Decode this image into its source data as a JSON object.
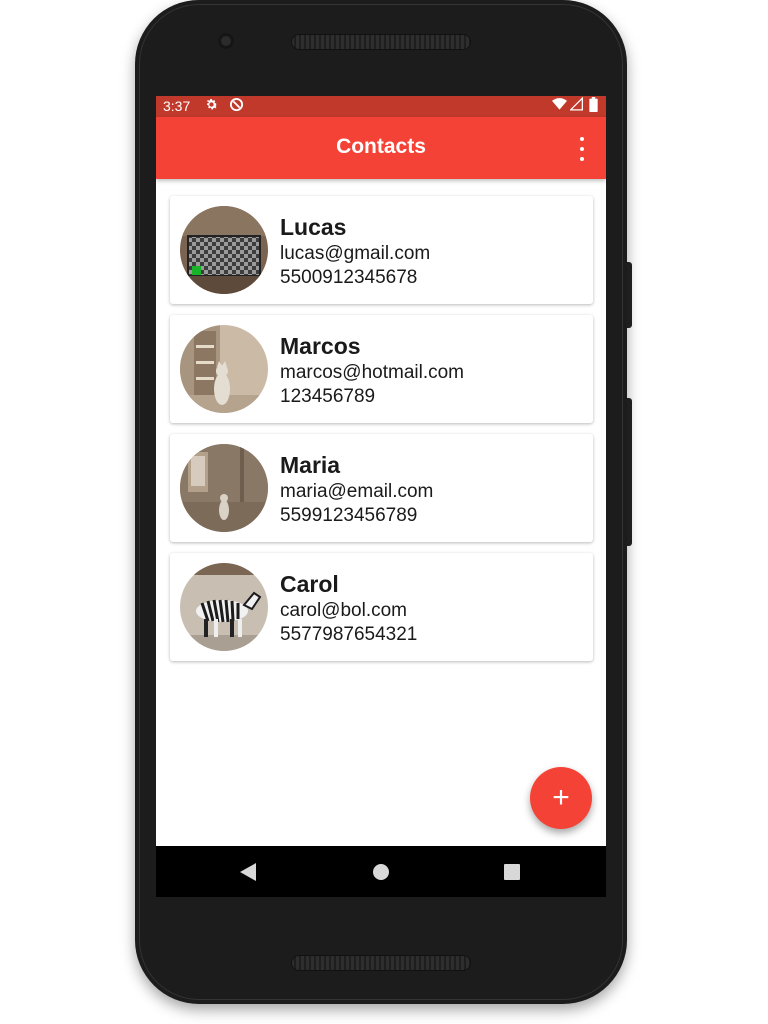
{
  "status_bar": {
    "time": "3:37",
    "icons": [
      "settings-icon",
      "sync-icon",
      "wifi-icon",
      "signal-icon",
      "battery-icon"
    ]
  },
  "app_bar": {
    "title": "Contacts",
    "menu_icon": "more-vert-icon"
  },
  "contacts": [
    {
      "name": "Lucas",
      "email": "lucas@gmail.com",
      "phone": "5500912345678",
      "avatar": "checkerboard-photo"
    },
    {
      "name": "Marcos",
      "email": "marcos@hotmail.com",
      "phone": "123456789",
      "avatar": "cat-room-photo"
    },
    {
      "name": "Maria",
      "email": "maria@email.com",
      "phone": "5599123456789",
      "avatar": "cat-room-photo-dark"
    },
    {
      "name": "Carol",
      "email": "carol@bol.com",
      "phone": "5577987654321",
      "avatar": "zebra-photo"
    }
  ],
  "fab": {
    "label": "+",
    "icon": "add-icon"
  },
  "nav_bar": {
    "icons": [
      "back-icon",
      "home-icon",
      "recents-icon"
    ]
  },
  "colors": {
    "status_bar": "#c0392b",
    "app_bar": "#f44336",
    "accent": "#f44336"
  }
}
